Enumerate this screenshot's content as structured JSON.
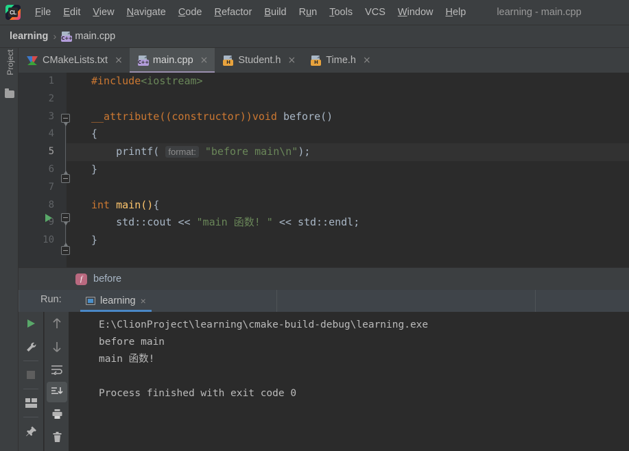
{
  "window": {
    "title": "learning - main.cpp",
    "logo_text": "CL"
  },
  "menubar": {
    "items": [
      {
        "name": "file",
        "label": "File",
        "mnemonic": "F"
      },
      {
        "name": "edit",
        "label": "Edit",
        "mnemonic": "E"
      },
      {
        "name": "view",
        "label": "View",
        "mnemonic": "V"
      },
      {
        "name": "navigate",
        "label": "Navigate",
        "mnemonic": "N"
      },
      {
        "name": "code",
        "label": "Code",
        "mnemonic": "C"
      },
      {
        "name": "refactor",
        "label": "Refactor",
        "mnemonic": "R"
      },
      {
        "name": "build",
        "label": "Build",
        "mnemonic": "B"
      },
      {
        "name": "run",
        "label": "Run",
        "mnemonic": "u"
      },
      {
        "name": "tools",
        "label": "Tools",
        "mnemonic": "T"
      },
      {
        "name": "vcs",
        "label": "VCS",
        "mnemonic": ""
      },
      {
        "name": "window",
        "label": "Window",
        "mnemonic": "W"
      },
      {
        "name": "help",
        "label": "Help",
        "mnemonic": "H"
      }
    ]
  },
  "navbar": {
    "project": "learning",
    "separator": "›",
    "file": "main.cpp",
    "file_icon": "cpp-file-icon"
  },
  "sidebar": {
    "project_label": "Project",
    "folder_icon": "folder-icon"
  },
  "tabs": [
    {
      "name": "cmakelists",
      "label": "CMakeLists.txt",
      "icon": "cmake-icon",
      "active": false,
      "close": "×"
    },
    {
      "name": "main-cpp",
      "label": "main.cpp",
      "icon": "cpp-file-icon",
      "active": true,
      "close": "×"
    },
    {
      "name": "student-h",
      "label": "Student.h",
      "icon": "h-file-icon",
      "active": false,
      "close": "×"
    },
    {
      "name": "time-h",
      "label": "Time.h",
      "icon": "h-file-icon",
      "active": false,
      "close": "×"
    }
  ],
  "editor": {
    "line_numbers": [
      "1",
      "2",
      "3",
      "4",
      "5",
      "6",
      "7",
      "8",
      "9",
      "10"
    ],
    "current_line": 5,
    "gutter_run_marker_line": 8,
    "lines": [
      {
        "n": "1",
        "text": "#include<iostream>"
      },
      {
        "n": "2",
        "text": ""
      },
      {
        "n": "3",
        "text": "__attribute((constructor))void before()"
      },
      {
        "n": "4",
        "text": "{"
      },
      {
        "n": "5",
        "text": "    printf( format: \"before main\\n\");"
      },
      {
        "n": "6",
        "text": "}"
      },
      {
        "n": "7",
        "text": ""
      },
      {
        "n": "8",
        "text": "int main(){"
      },
      {
        "n": "9",
        "text": "    std::cout << \"main 函数! \" << std::endl;"
      },
      {
        "n": "10",
        "text": "}"
      }
    ],
    "tokens": {
      "include_directive": "#include",
      "include_target": "<iostream>",
      "attribute": "__attribute((constructor))",
      "void_kw": "void",
      "before_fn": "before()",
      "open_brace": "{",
      "close_brace": "}",
      "printf_fn": "printf(",
      "param_hint": "format:",
      "printf_str": "\"before main\\n\"",
      "printf_tail": ");",
      "int_kw": "int",
      "main_fn": "main()",
      "main_brace": "{",
      "std_cout": "std::cout",
      "shift_op": "<<",
      "cout_str": "\"main 函数! \"",
      "std_endl": "std::endl",
      "semicolon": ";"
    }
  },
  "structbar": {
    "badge": "f",
    "label": "before"
  },
  "run_panel": {
    "header_label": "Run:",
    "tab_label": "learning",
    "tab_icon": "window-icon",
    "tab_close": "×",
    "toolbar_left": [
      {
        "name": "rerun-button",
        "icon": "play-icon"
      },
      {
        "name": "configure-button",
        "icon": "wrench-icon"
      },
      {
        "name": "stop-button",
        "icon": "stop-icon"
      },
      {
        "name": "layout-button",
        "icon": "layout-icon"
      },
      {
        "name": "pin-button",
        "icon": "pin-icon"
      }
    ],
    "toolbar_right": [
      {
        "name": "prev-occurrence-button",
        "icon": "arrow-up-icon"
      },
      {
        "name": "next-occurrence-button",
        "icon": "arrow-down-icon"
      },
      {
        "name": "soft-wrap-button",
        "icon": "wrap-icon"
      },
      {
        "name": "scroll-to-end-button",
        "icon": "scroll-end-icon",
        "selected": true
      },
      {
        "name": "print-button",
        "icon": "printer-icon"
      },
      {
        "name": "clear-all-button",
        "icon": "trash-icon"
      }
    ],
    "console_lines": [
      "E:\\ClionProject\\learning\\cmake-build-debug\\learning.exe",
      "before main",
      "main 函数!",
      "",
      "Process finished with exit code 0"
    ]
  },
  "colors": {
    "chrome": "#3c3f41",
    "editor_bg": "#2b2b2b",
    "gutter_bg": "#313335",
    "tab_active_bg": "#4e5254",
    "run_header_bg": "#3f4449",
    "accent_blue": "#4a88c7",
    "keyword_orange": "#cc7832",
    "string_green": "#6a8759",
    "function_yellow": "#ffc66d",
    "text_gray": "#a9b7c6",
    "run_green": "#59a869"
  }
}
